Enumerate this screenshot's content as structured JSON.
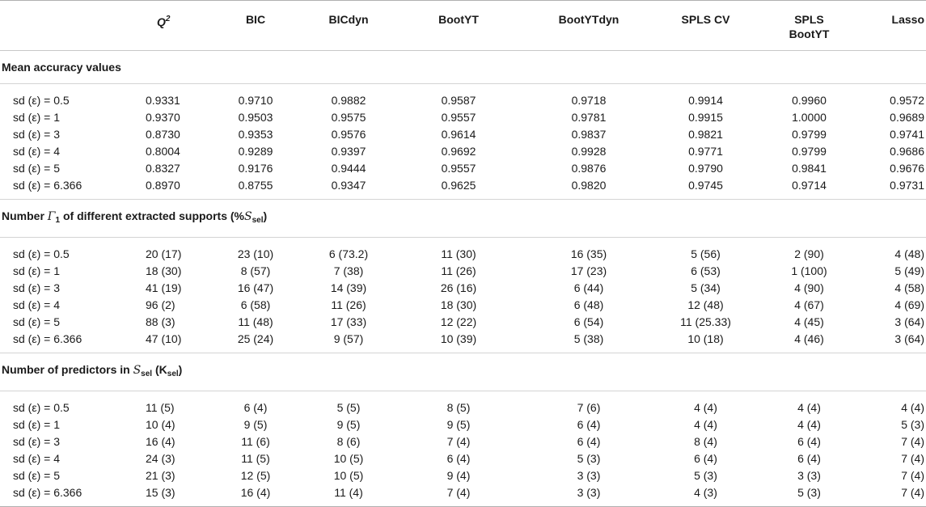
{
  "headers": {
    "q2": "Q",
    "q2_sup": "2",
    "bic": "BIC",
    "bicdyn": "BICdyn",
    "bootyt": "BootYT",
    "bootytdyn": "BootYTdyn",
    "spls_cv": "SPLS CV",
    "spls_bootyt_1": "SPLS",
    "spls_bootyt_2": "BootYT",
    "lasso": "Lasso"
  },
  "sections": {
    "accuracy": {
      "title": "Mean accuracy values",
      "rows": [
        {
          "label": "sd (ε) = 0.5",
          "values": [
            "0.9331",
            "0.9710",
            "0.9882",
            "0.9587",
            "0.9718",
            "0.9914",
            "0.9960",
            "0.9572"
          ]
        },
        {
          "label": "sd (ε) = 1",
          "values": [
            "0.9370",
            "0.9503",
            "0.9575",
            "0.9557",
            "0.9781",
            "0.9915",
            "1.0000",
            "0.9689"
          ]
        },
        {
          "label": "sd (ε) = 3",
          "values": [
            "0.8730",
            "0.9353",
            "0.9576",
            "0.9614",
            "0.9837",
            "0.9821",
            "0.9799",
            "0.9741"
          ]
        },
        {
          "label": "sd (ε) = 4",
          "values": [
            "0.8004",
            "0.9289",
            "0.9397",
            "0.9692",
            "0.9928",
            "0.9771",
            "0.9799",
            "0.9686"
          ]
        },
        {
          "label": "sd (ε) = 5",
          "values": [
            "0.8327",
            "0.9176",
            "0.9444",
            "0.9557",
            "0.9876",
            "0.9790",
            "0.9841",
            "0.9676"
          ]
        },
        {
          "label": "sd (ε) = 6.366",
          "values": [
            "0.8970",
            "0.8755",
            "0.9347",
            "0.9625",
            "0.9820",
            "0.9745",
            "0.9714",
            "0.9731"
          ]
        }
      ]
    },
    "supports": {
      "title_a": "Number ",
      "title_gamma": "Γ",
      "title_gamma_sub": "1",
      "title_b": " of different extracted supports (%",
      "title_s": "S",
      "title_s_sub": "sel",
      "title_c": ")",
      "rows": [
        {
          "label": "sd (ε) = 0.5",
          "values": [
            "20 (17)",
            "23 (10)",
            "6 (73.2)",
            "11 (30)",
            "16 (35)",
            "5 (56)",
            "2 (90)",
            "4 (48)"
          ]
        },
        {
          "label": "sd (ε) = 1",
          "values": [
            "18 (30)",
            "8 (57)",
            "7 (38)",
            "11 (26)",
            "17 (23)",
            "6 (53)",
            "1 (100)",
            "5 (49)"
          ]
        },
        {
          "label": "sd (ε) = 3",
          "values": [
            "41 (19)",
            "16 (47)",
            "14 (39)",
            "26 (16)",
            "6 (44)",
            "5 (34)",
            "4 (90)",
            "4 (58)"
          ]
        },
        {
          "label": "sd (ε) = 4",
          "values": [
            "96 (2)",
            "6 (58)",
            "11 (26)",
            "18 (30)",
            "6 (48)",
            "12 (48)",
            "4 (67)",
            "4 (69)"
          ]
        },
        {
          "label": "sd (ε) = 5",
          "values": [
            "88 (3)",
            "11 (48)",
            "17 (33)",
            "12 (22)",
            "6 (54)",
            "11 (25.33)",
            "4 (45)",
            "3 (64)"
          ]
        },
        {
          "label": "sd (ε) = 6.366",
          "values": [
            "47 (10)",
            "25 (24)",
            "9 (57)",
            "10 (39)",
            "5 (38)",
            "10 (18)",
            "4 (46)",
            "3 (64)"
          ]
        }
      ]
    },
    "predictors": {
      "title_a": "Number of predictors in ",
      "title_s": "S",
      "title_s_sub": "sel",
      "title_b": " (",
      "title_k": "K",
      "title_k_sub": "sel",
      "title_c": ")",
      "rows": [
        {
          "label": "sd (ε) = 0.5",
          "values": [
            "11 (5)",
            "6 (4)",
            "5 (5)",
            "8 (5)",
            "7 (6)",
            "4 (4)",
            "4 (4)",
            "4 (4)"
          ]
        },
        {
          "label": "sd (ε) = 1",
          "values": [
            "10 (4)",
            "9 (5)",
            "9 (5)",
            "9 (5)",
            "6 (4)",
            "4 (4)",
            "4 (4)",
            "5 (3)"
          ]
        },
        {
          "label": "sd (ε) = 3",
          "values": [
            "16 (4)",
            "11 (6)",
            "8 (6)",
            "7 (4)",
            "6 (4)",
            "8 (4)",
            "6 (4)",
            "7 (4)"
          ]
        },
        {
          "label": "sd (ε) = 4",
          "values": [
            "24 (3)",
            "11 (5)",
            "10 (5)",
            "6 (4)",
            "5 (3)",
            "6 (4)",
            "6 (4)",
            "7 (4)"
          ]
        },
        {
          "label": "sd (ε) = 5",
          "values": [
            "21 (3)",
            "12 (5)",
            "10 (5)",
            "9 (4)",
            "3 (3)",
            "5 (3)",
            "3 (3)",
            "7 (4)"
          ]
        },
        {
          "label": "sd (ε) = 6.366",
          "values": [
            "15 (3)",
            "16 (4)",
            "11 (4)",
            "7 (4)",
            "3 (3)",
            "4 (3)",
            "5 (3)",
            "7 (4)"
          ]
        }
      ]
    }
  }
}
